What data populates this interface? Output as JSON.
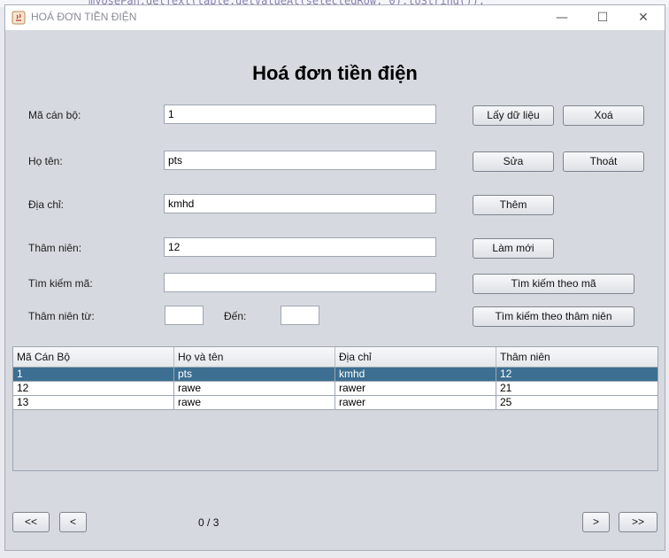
{
  "background_code": "myUsePan.getText(table.getValueAt(selectedRow, 0).toString());",
  "window": {
    "title": "HOÁ ĐƠN TIỀN ĐIỆN",
    "minimize": "—",
    "maximize": "☐",
    "close": "✕"
  },
  "heading": "Hoá đơn tiền điện",
  "form": {
    "ma_can_bo": {
      "label": "Mã cán bộ:",
      "value": "1"
    },
    "ho_ten": {
      "label": "Họ tên:",
      "value": "pts"
    },
    "dia_chi": {
      "label": "Địa chỉ:",
      "value": "kmhd"
    },
    "tham_nien": {
      "label": "Thâm niên:",
      "value": "12"
    },
    "tim_kiem_ma": {
      "label": "Tìm kiếm mã:",
      "value": ""
    },
    "tham_nien_tu": {
      "label": "Thâm niên từ:",
      "value": ""
    },
    "den": {
      "label": "Đến:",
      "value": ""
    }
  },
  "buttons": {
    "lay_du_lieu": "Lấy dữ liệu",
    "xoa": "Xoá",
    "sua": "Sửa",
    "thoat": "Thoát",
    "them": "Thêm",
    "lam_moi": "Làm mới",
    "tim_kiem_theo_ma": "Tìm kiếm theo mã",
    "tim_kiem_theo_tham_nien": "Tìm kiếm theo thâm niên"
  },
  "table": {
    "headers": [
      "Mã Cán Bộ",
      "Họ và tên",
      "Địa chỉ",
      "Thâm niên"
    ],
    "rows": [
      [
        "1",
        "pts",
        "kmhd",
        "12"
      ],
      [
        "12",
        "rawe",
        "rawer",
        "21"
      ],
      [
        "13",
        "rawe",
        "rawer",
        "25"
      ]
    ],
    "selected_row": 0
  },
  "pager": {
    "first": "<<",
    "prev": "<",
    "current": "0",
    "sep": "/",
    "total": "3",
    "next": ">",
    "last": ">>"
  },
  "colors": {
    "selected_row": "#3c6f91",
    "window_bg": "#d6d9df"
  }
}
